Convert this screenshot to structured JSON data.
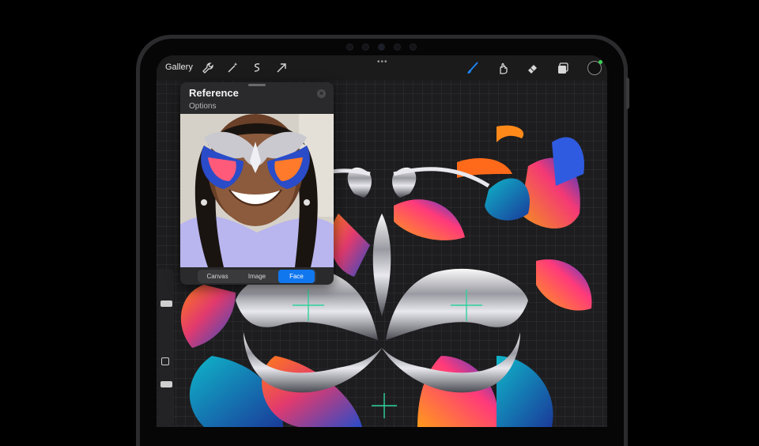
{
  "toolbar": {
    "gallery_label": "Gallery",
    "left_tools": [
      "wrench-icon",
      "magic-wand-icon",
      "selection-icon",
      "transform-arrow-icon"
    ],
    "right_tools": [
      "brush-icon",
      "smudge-icon",
      "eraser-icon",
      "layers-icon"
    ],
    "active_tool": "brush-icon",
    "active_color": "#1e88ff",
    "current_color_indicator": "#39d353"
  },
  "reference_panel": {
    "title": "Reference",
    "subtitle": "Options",
    "modes": [
      "Canvas",
      "Image",
      "Face"
    ],
    "selected_mode": "Face"
  },
  "sidebar": {
    "brush_size_label": "",
    "opacity_label": ""
  },
  "colors": {
    "accent": "#1177ee",
    "canvas_bg": "#1d1d1f",
    "guide_green": "#2fd39b"
  }
}
